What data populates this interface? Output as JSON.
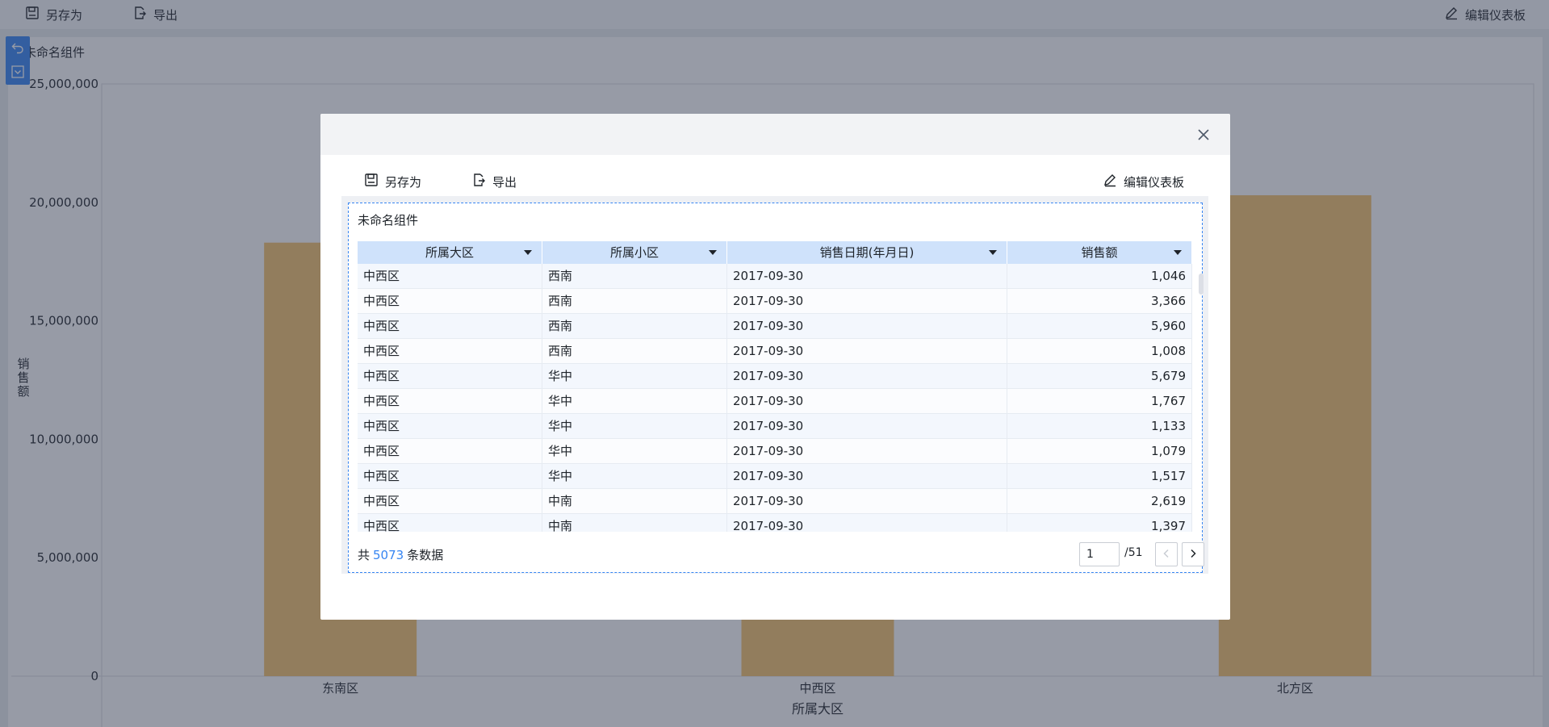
{
  "toolbar": {
    "save_as": "另存为",
    "export": "导出",
    "edit_dashboard": "编辑仪表板"
  },
  "chart_data": {
    "type": "bar",
    "title": "未命名组件",
    "xlabel": "所属大区",
    "ylabel": "销售额",
    "categories": [
      "东南区",
      "中西区",
      "北方区"
    ],
    "values": [
      18300000,
      2500000,
      20300000
    ],
    "ylim": [
      0,
      25000000
    ],
    "yticks": [
      0,
      5000000,
      10000000,
      15000000,
      20000000,
      25000000
    ],
    "ytick_labels": [
      "0",
      "5,000,000",
      "10,000,000",
      "15,000,000",
      "20,000,000",
      "25,000,000"
    ],
    "bar_color": "#f5c36d",
    "grid": false
  },
  "modal": {
    "toolbar": {
      "save_as": "另存为",
      "export": "导出",
      "edit_dashboard": "编辑仪表板"
    },
    "widget_title": "未命名组件",
    "columns": [
      "所属大区",
      "所属小区",
      "销售日期(年月日)",
      "销售额"
    ],
    "rows": [
      [
        "中西区",
        "西南",
        "2017-09-30",
        "1,046"
      ],
      [
        "中西区",
        "西南",
        "2017-09-30",
        "3,366"
      ],
      [
        "中西区",
        "西南",
        "2017-09-30",
        "5,960"
      ],
      [
        "中西区",
        "西南",
        "2017-09-30",
        "1,008"
      ],
      [
        "中西区",
        "华中",
        "2017-09-30",
        "5,679"
      ],
      [
        "中西区",
        "华中",
        "2017-09-30",
        "1,767"
      ],
      [
        "中西区",
        "华中",
        "2017-09-30",
        "1,133"
      ],
      [
        "中西区",
        "华中",
        "2017-09-30",
        "1,079"
      ],
      [
        "中西区",
        "华中",
        "2017-09-30",
        "1,517"
      ],
      [
        "中西区",
        "中南",
        "2017-09-30",
        "2,619"
      ],
      [
        "中西区",
        "中南",
        "2017-09-30",
        "1,397"
      ]
    ],
    "footer": {
      "prefix": "共",
      "count": "5073",
      "suffix": "条数据",
      "page": "1",
      "total_pages": "/51"
    }
  },
  "colors": {
    "accent": "#3685f2",
    "header_bg": "#cfe2fb",
    "bar": "#f5c36d"
  },
  "icons": [
    "save-icon",
    "export-icon",
    "edit-icon",
    "undo-icon",
    "collapse-icon",
    "close-icon",
    "prev-page-icon",
    "next-page-icon"
  ]
}
